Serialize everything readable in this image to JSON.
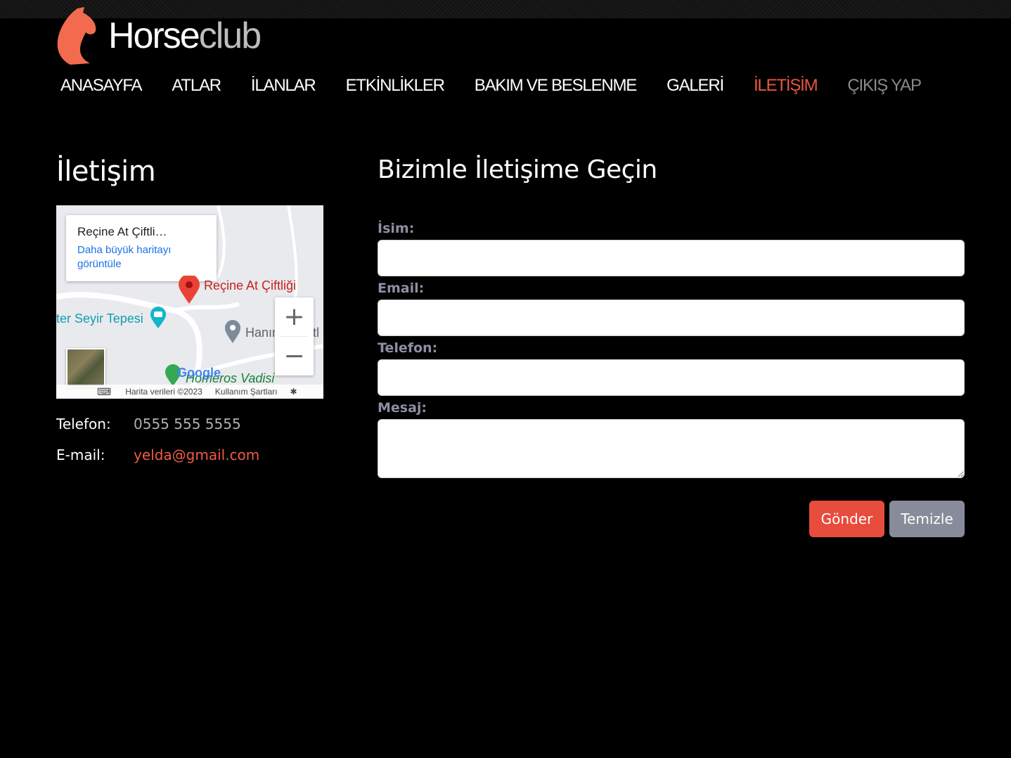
{
  "brand": {
    "name_main": "Horse",
    "name_sub": "club",
    "accent": "#e8563f"
  },
  "nav": {
    "items": [
      {
        "label": "ANASAYFA"
      },
      {
        "label": "ATLAR"
      },
      {
        "label": "İLANLAR"
      },
      {
        "label": "ETKİNLİKLER"
      },
      {
        "label": "BAKIM VE BESLENME"
      },
      {
        "label": "GALERİ"
      },
      {
        "label": "İLETİŞİM",
        "active": true
      },
      {
        "label": "ÇIKIŞ YAP"
      }
    ]
  },
  "contact": {
    "title": "İletişim",
    "map": {
      "place_title": "Reçine At Çiftli…",
      "link": "Daha büyük haritayı görüntüle",
      "marker_label": "Reçine At Çiftliği",
      "poi_1": "ter Seyir Tepesi",
      "poi_2": "Hanım",
      "poi_3": "ftl",
      "poi_4": "Homeros Vadisi",
      "google": "Google",
      "footer_data": "Harita verileri ©2023",
      "footer_terms": "Kullanım Şartları"
    },
    "phone_label": "Telefon:",
    "phone_value": "0555 555 5555",
    "email_label": "E-mail:",
    "email_value": "yelda@gmail.com"
  },
  "form": {
    "title": "Bizimle İletişime Geçin",
    "name_label": "İsim:",
    "email_label": "Email:",
    "phone_label": "Telefon:",
    "message_label": "Mesaj:",
    "submit_label": "Gönder",
    "reset_label": "Temizle"
  }
}
